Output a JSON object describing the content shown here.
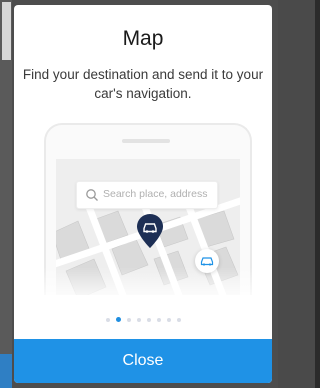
{
  "modal": {
    "title": "Map",
    "description": "Find your destination and send it to your car's navigation.",
    "close_label": "Close"
  },
  "illustration": {
    "search_placeholder": "Search place, address",
    "pin_icon": "car-pin-icon",
    "fab_icon": "car-icon"
  },
  "pagination": {
    "total": 8,
    "active_index": 1
  },
  "colors": {
    "accent": "#1f92e6",
    "pin": "#1d2f55",
    "overlay": "#4d4d4d"
  }
}
